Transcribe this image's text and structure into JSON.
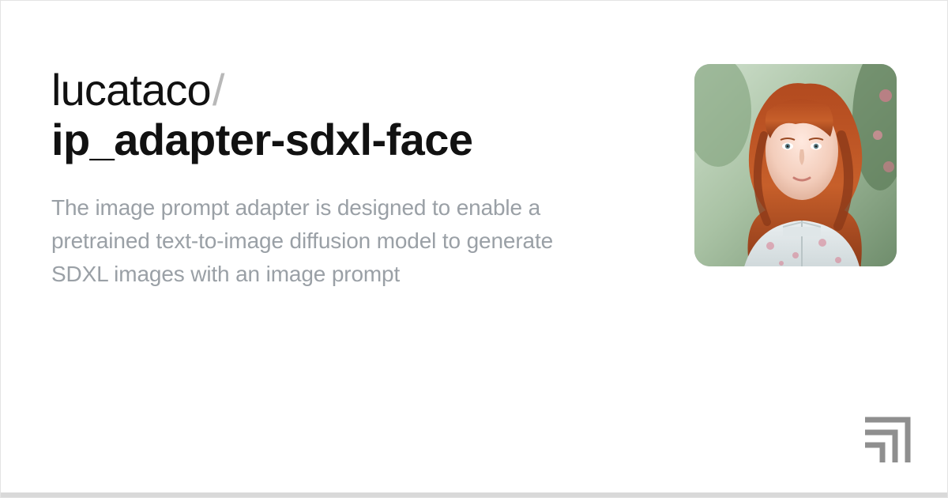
{
  "owner": "lucataco",
  "separator": "/",
  "model_name": "ip_adapter-sdxl-face",
  "description": "The image prompt adapter is designed to enable a pretrained text-to-image diffusion model to generate SDXL images with an image prompt",
  "preview_alt": "portrait-woman-red-hair",
  "logo_name": "replicate-logo"
}
